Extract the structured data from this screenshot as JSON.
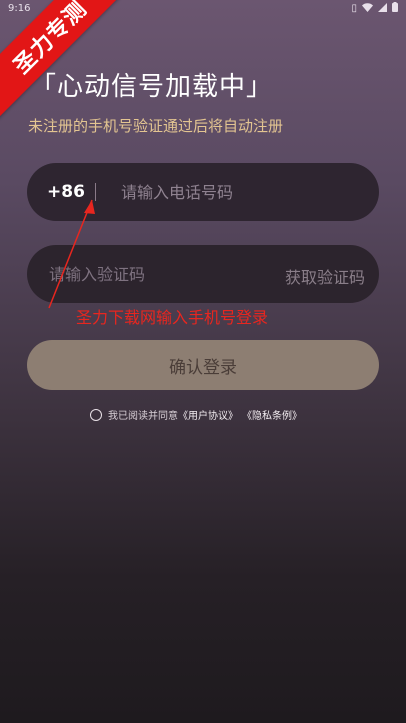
{
  "status_bar": {
    "time": "9:16",
    "icons": [
      "vibrate-icon",
      "wifi-icon",
      "signal-icon",
      "battery-icon"
    ]
  },
  "badge": {
    "text": "圣力专测",
    "color": "#e21616"
  },
  "header": {
    "title": "「心动信号加载中」",
    "subtitle": "未注册的手机号验证通过后将自动注册"
  },
  "phone": {
    "country_code": "+86",
    "placeholder": "请输入电话号码"
  },
  "verification": {
    "placeholder": "请输入验证码",
    "get_code_label": "获取验证码"
  },
  "annotation": {
    "text": "圣力下载网输入手机号登录",
    "color": "#e8261f"
  },
  "login": {
    "label": "确认登录"
  },
  "agreement": {
    "prefix": "我已阅读并同意",
    "user_agreement": "《用户协议》",
    "privacy_policy": "《隐私条例》"
  },
  "colors": {
    "accent_gold": "#e3c591",
    "button_bg": "#8d7e72"
  }
}
